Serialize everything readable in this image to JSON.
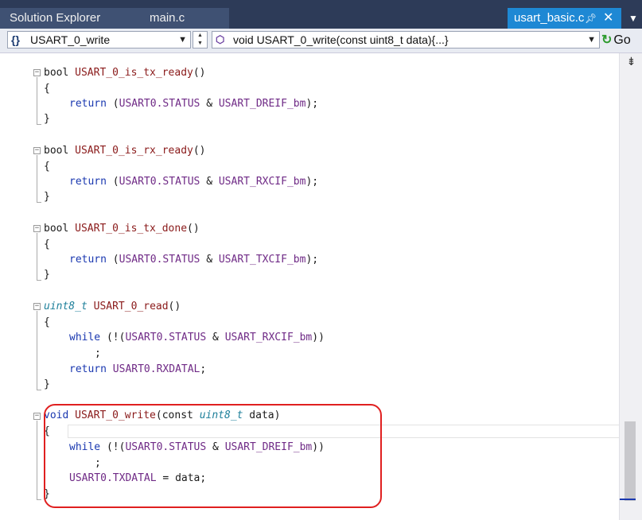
{
  "tabs": {
    "solution_explorer": "Solution Explorer",
    "main_c": "main.c",
    "active": "usart_basic.c",
    "pin_icon": "pin-icon",
    "close_icon": "close-icon"
  },
  "navbar": {
    "function_combo": "USART_0_write",
    "signature_combo": "void USART_0_write(const uint8_t data){...}",
    "go_label": "Go"
  },
  "code": {
    "fn1": {
      "ret": "bool",
      "name": "USART_0_is_tx_ready",
      "paren": "()",
      "reg": "USART0.STATUS",
      "mask": "USART_DREIF_bm"
    },
    "fn2": {
      "ret": "bool",
      "name": "USART_0_is_rx_ready",
      "paren": "()",
      "reg": "USART0.STATUS",
      "mask": "USART_RXCIF_bm"
    },
    "fn3": {
      "ret": "bool",
      "name": "USART_0_is_tx_done",
      "paren": "()",
      "reg": "USART0.STATUS",
      "mask": "USART_TXCIF_bm"
    },
    "fn4": {
      "ret": "uint8_t",
      "name": "USART_0_read",
      "paren": "()",
      "reg": "USART0.STATUS",
      "mask": "USART_RXCIF_bm",
      "retval": "USART0.RXDATAL"
    },
    "fn5": {
      "ret": "void",
      "name": "USART_0_write",
      "params_pre": "(const ",
      "ptype": "uint8_t",
      "params_post": " data)",
      "reg": "USART0.STATUS",
      "mask": "USART_DREIF_bm",
      "assign_lhs": "USART0.TXDATAL",
      "assign_rhs": "data"
    },
    "kw_return": "return",
    "kw_while": "while",
    "open_brace": "{",
    "close_brace": "}",
    "semicolon": ";",
    "amp": " & ",
    "lparen": " (",
    "rparen": ");",
    "while_open": " (!(",
    "while_close": "))",
    "assign_op": " = ",
    "end_semi": ";"
  }
}
